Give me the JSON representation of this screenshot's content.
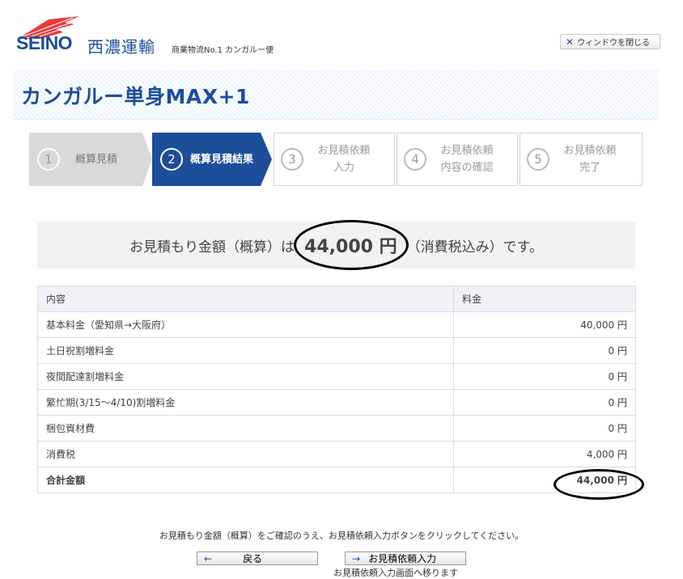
{
  "header": {
    "logo_text": "SEINO",
    "company_name": "西濃運輸",
    "tagline": "商業物流No.1 カンガルー便",
    "close_label": "ウィンドウを閉じる"
  },
  "banner": {
    "title": "カンガルー単身MAX+1"
  },
  "steps": [
    {
      "num": "1",
      "label": "概算見積"
    },
    {
      "num": "2",
      "label": "概算見積結果"
    },
    {
      "num": "3",
      "label_line1": "お見積依頼",
      "label_line2": "入力"
    },
    {
      "num": "4",
      "label_line1": "お見積依頼",
      "label_line2": "内容の確認"
    },
    {
      "num": "5",
      "label_line1": "お見積依頼",
      "label_line2": "完了"
    }
  ],
  "summary": {
    "prefix": "お見積もり金額（概算）は",
    "amount": "44,000 円",
    "suffix": "（消費税込み）です。"
  },
  "table": {
    "headers": [
      "内容",
      "料金"
    ],
    "rows": [
      {
        "item": "基本料金（愛知県→大阪府）",
        "price": "40,000 円"
      },
      {
        "item": "土日祝割増料金",
        "price": "0 円"
      },
      {
        "item": "夜間配達割増料金",
        "price": "0 円"
      },
      {
        "item": "繁忙期(3/15〜4/10)割増料金",
        "price": "0 円"
      },
      {
        "item": "梱包資材費",
        "price": "0 円"
      },
      {
        "item": "消費税",
        "price": "4,000 円"
      }
    ],
    "total": {
      "item": "合計金額",
      "price": "44,000 円"
    }
  },
  "footer": {
    "note": "お見積もり金額（概算）をご確認のうえ、お見積依頼入力ボタンをクリックしてください。",
    "back_label": "戻る",
    "next_label": "お見積依頼入力",
    "subnote": "お見積依頼入力画面へ移ります"
  }
}
